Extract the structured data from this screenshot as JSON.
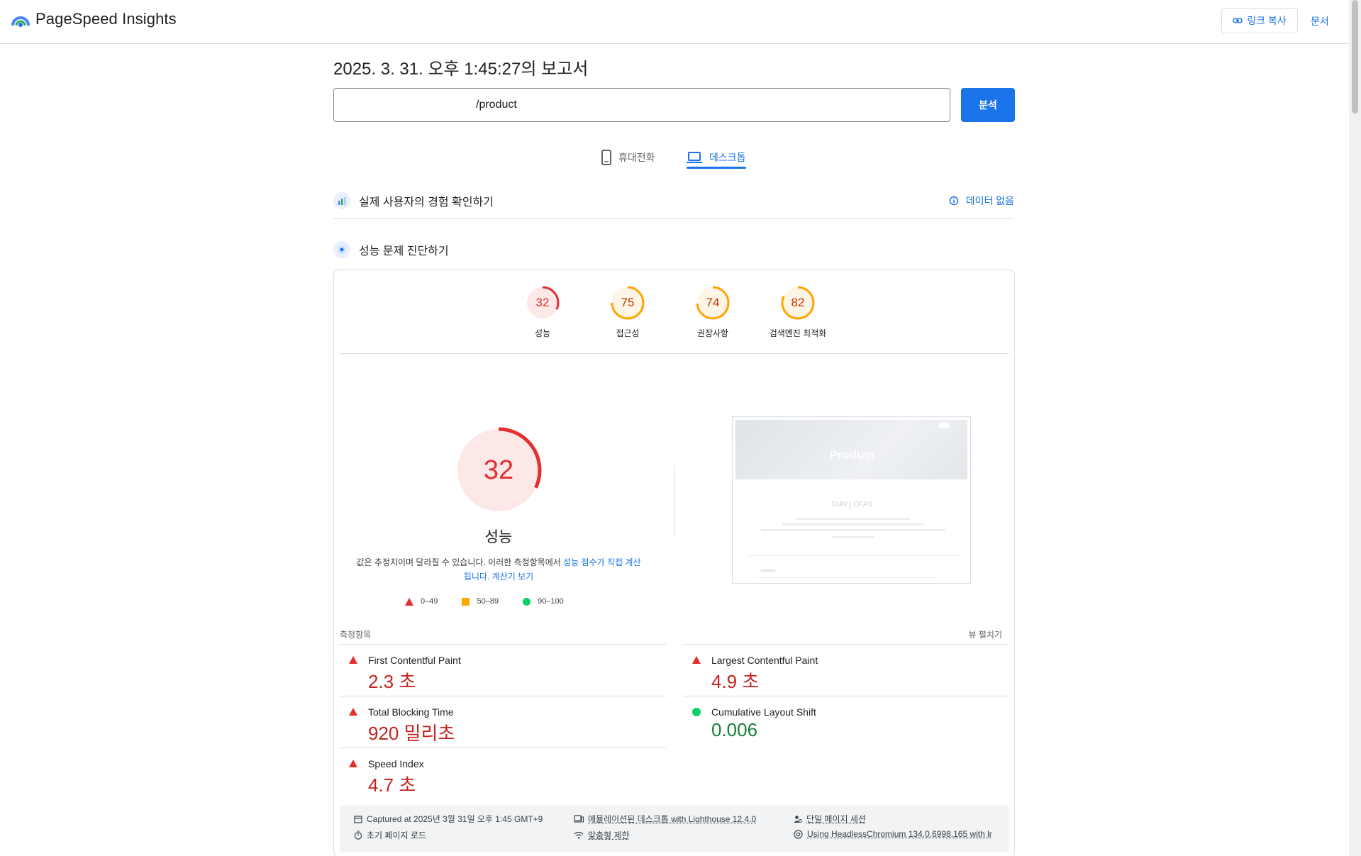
{
  "header": {
    "app_name": "PageSpeed Insights",
    "copy_link_label": "링크 복사",
    "docs_label": "문서"
  },
  "report": {
    "title": "2025. 3. 31. 오후 1:45:27의 보고서",
    "url_value": "/product",
    "analyze_label": "분석"
  },
  "tabs": [
    {
      "label": "휴대전화",
      "icon": "smartphone-icon",
      "active": false
    },
    {
      "label": "데스크톱",
      "icon": "laptop-icon",
      "active": true
    }
  ],
  "crux": {
    "title": "실제 사용자의 경험 확인하기",
    "status": "데이터 없음"
  },
  "diagnose": {
    "title": "성능 문제 진단하기"
  },
  "scores": [
    {
      "value": 32,
      "label": "성능",
      "status": "fail"
    },
    {
      "value": 75,
      "label": "접근성",
      "status": "average"
    },
    {
      "value": 74,
      "label": "권장사항",
      "status": "average"
    },
    {
      "value": 82,
      "label": "검색엔진 최적화",
      "status": "average"
    }
  ],
  "performance": {
    "score": 32,
    "label": "성능",
    "disclaimer_text": "값은 추정치이며 달라질 수 있습니다. 이러한 측정항목에서 ",
    "disclaimer_link1": "성능 점수가 직접 계산됩니다.",
    "disclaimer_link2": "계산기 보기"
  },
  "legend": [
    {
      "range": "0–49",
      "shape": "triangle",
      "color": "#e52e2e"
    },
    {
      "range": "50–89",
      "shape": "square",
      "color": "#ffa400"
    },
    {
      "range": "90–100",
      "shape": "circle",
      "color": "#0cce6b"
    }
  ],
  "screenshot": {
    "hero_text": "Product",
    "subheading": "DIAV | OFAS"
  },
  "metrics_header": {
    "label": "측정항목",
    "expand_label": "뷰 펼치기"
  },
  "metrics": [
    {
      "name": "First Contentful Paint",
      "value": "2.3 초",
      "status": "fail"
    },
    {
      "name": "Largest Contentful Paint",
      "value": "4.9 초",
      "status": "fail"
    },
    {
      "name": "Total Blocking Time",
      "value": "920 밀리초",
      "status": "fail"
    },
    {
      "name": "Cumulative Layout Shift",
      "value": "0.006",
      "status": "pass"
    },
    {
      "name": "Speed Index",
      "value": "4.7 초",
      "status": "fail"
    }
  ],
  "run_info": {
    "captured": "Captured at 2025년 3월 31일 오후 1:45 GMT+9",
    "initial_load": "초기 페이지 로드",
    "emulated": "에뮬레이션된 데스크톱 with Lighthouse 12.4.0",
    "throttling": "맞춤형 제한",
    "session": "단일 페이지 세션",
    "browser": "Using HeadlessChromium 134.0.6998.165 with lr"
  },
  "colors": {
    "accent": "#1a73e8",
    "fail": "#e52e2e",
    "average": "#ffa400",
    "pass": "#0cce6b"
  }
}
